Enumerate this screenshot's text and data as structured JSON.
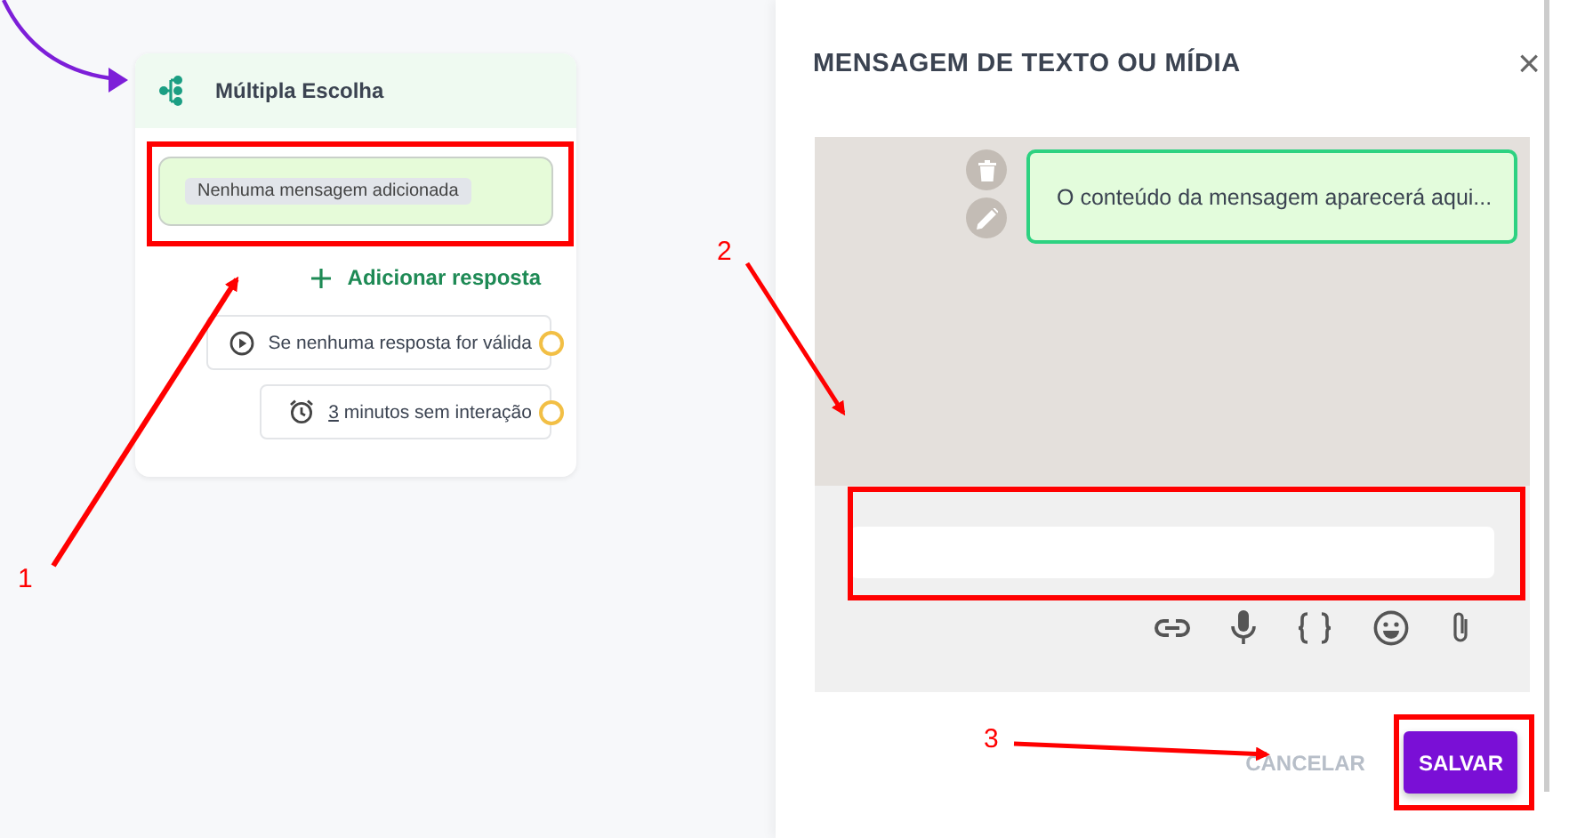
{
  "canvas": {
    "node": {
      "title": "Múltipla Escolha",
      "message_placeholder": "Nenhuma mensagem adicionada",
      "add_button": "Adicionar resposta",
      "outputs": [
        {
          "kind": "fallback",
          "text": "Se nenhuma resposta for válida"
        },
        {
          "kind": "timeout",
          "value": "3",
          "text": "minutos sem interação"
        }
      ]
    }
  },
  "dialog": {
    "title": "MENSAGEM DE TEXTO OU MÍDIA",
    "close": "×",
    "preview_bubble": "O conteúdo da mensagem aparecerá aqui...",
    "buttons": [
      {
        "kind": "secondary",
        "label": "CANCELAR"
      },
      {
        "kind": "primary",
        "label": "SALVAR"
      }
    ]
  },
  "annotations": [
    {
      "label": "1"
    },
    {
      "label": "2"
    },
    {
      "label": "3"
    }
  ]
}
